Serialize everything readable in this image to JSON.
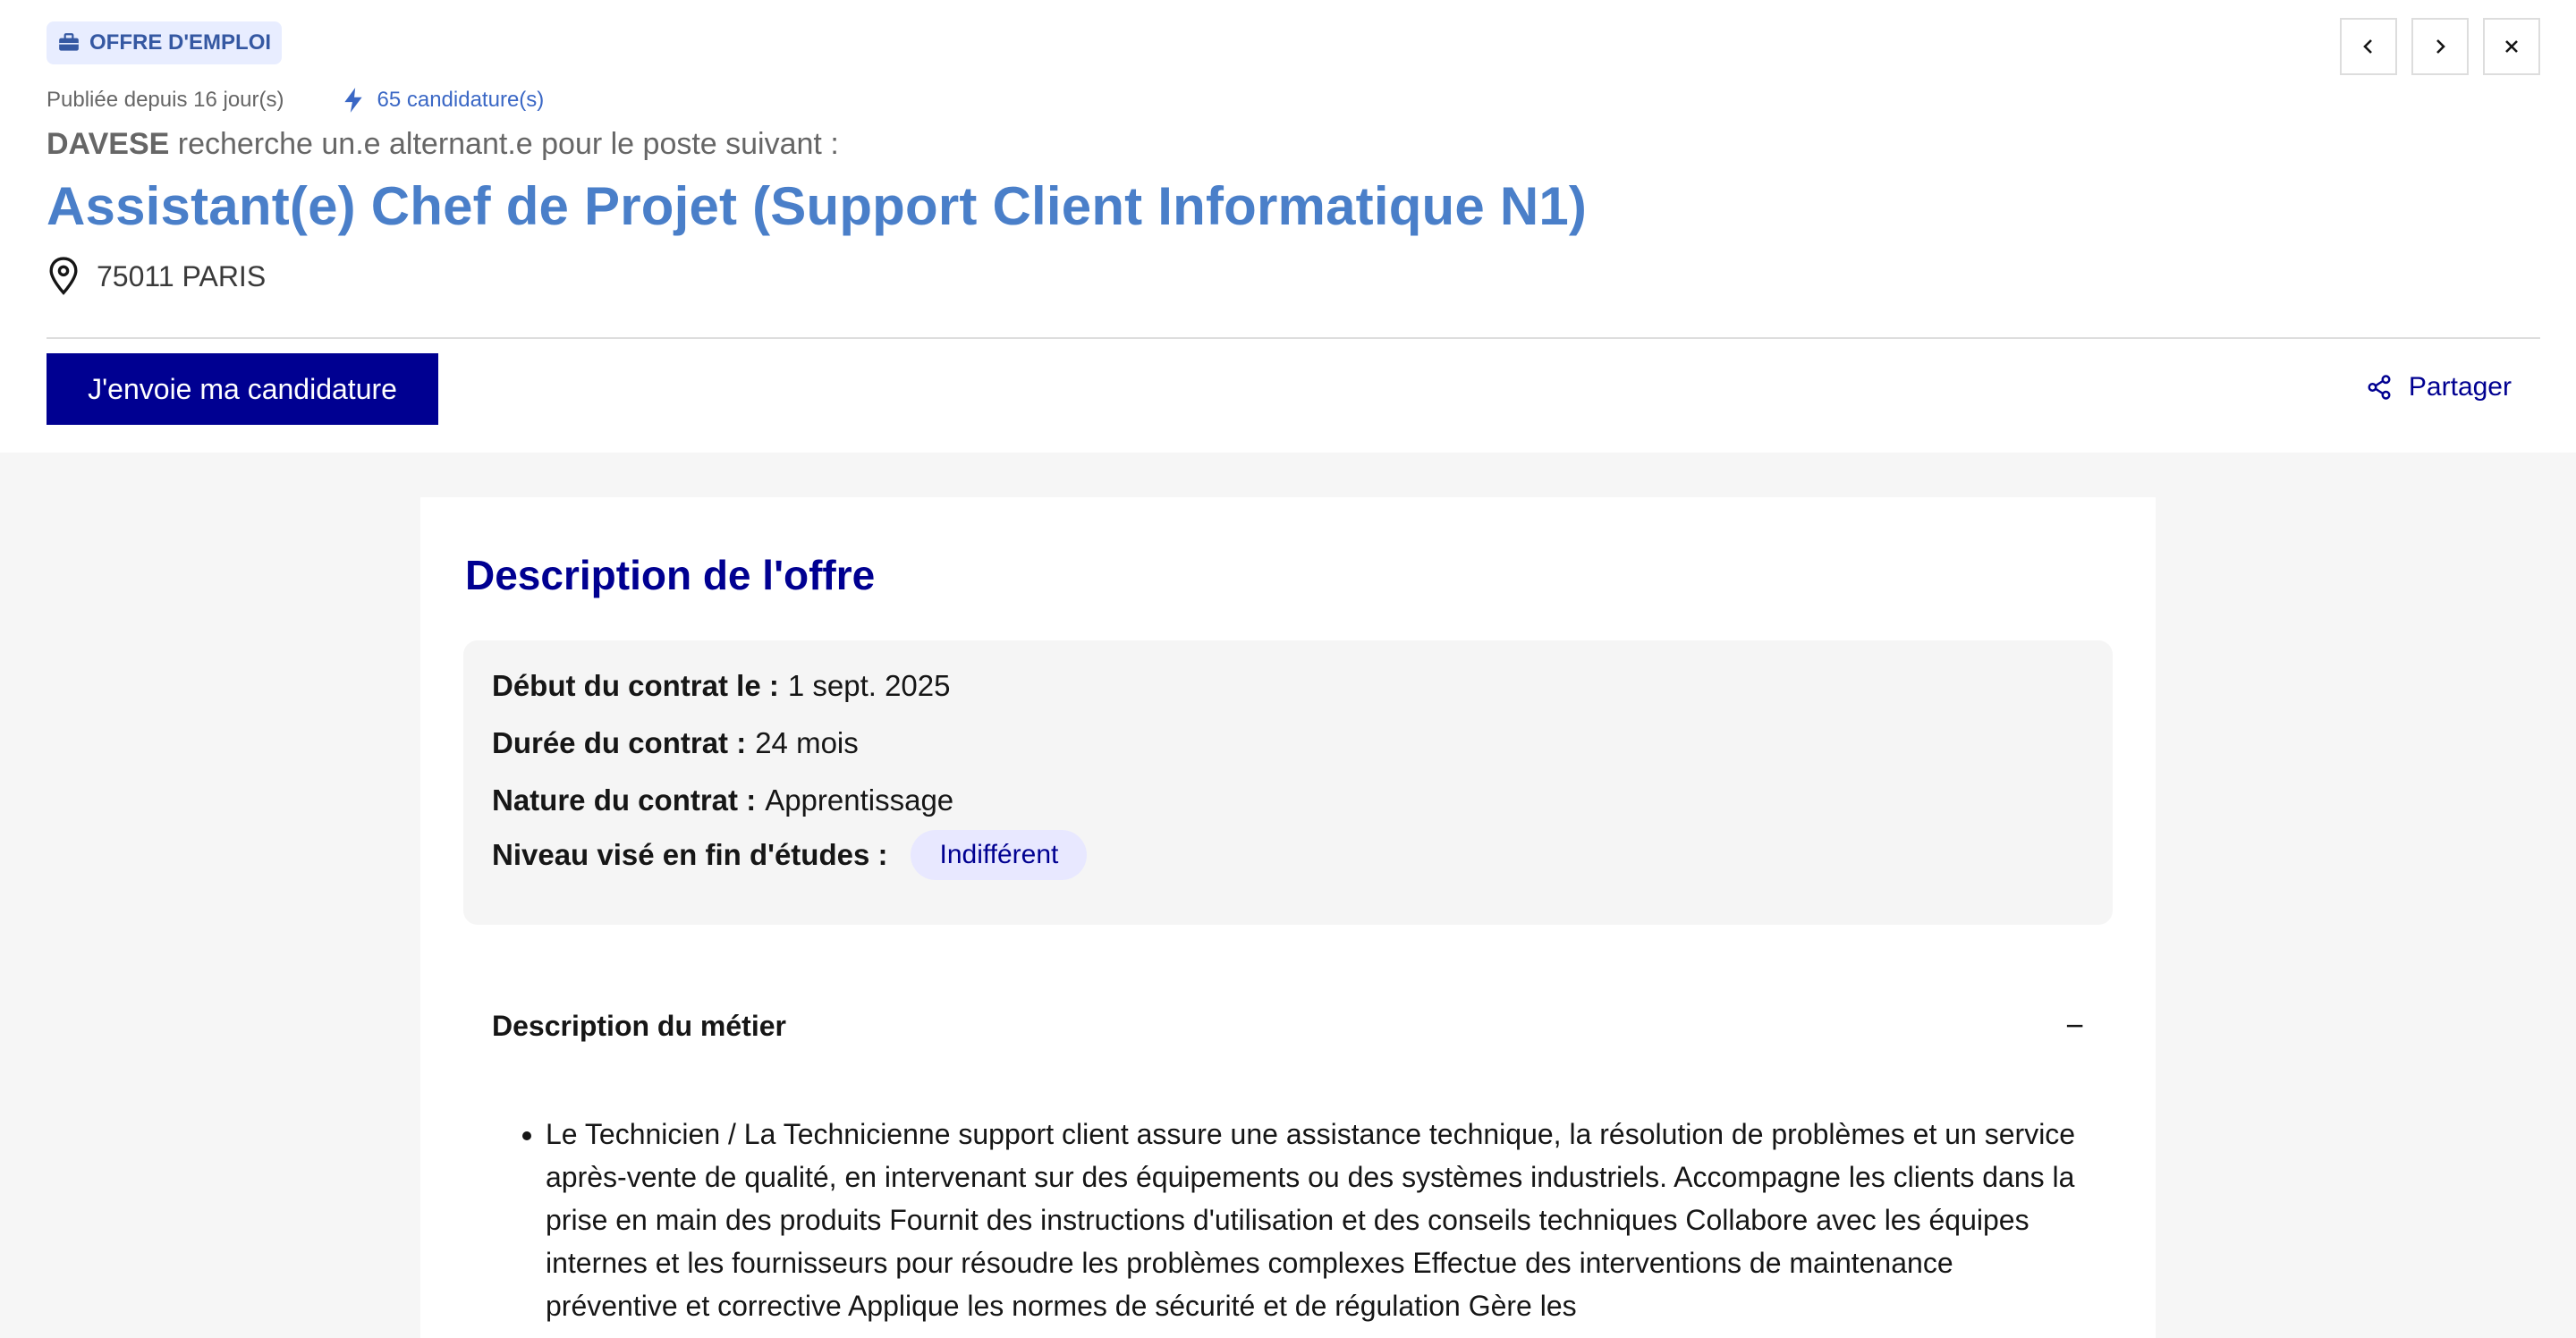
{
  "header": {
    "badge_label": "OFFRE D'EMPLOI",
    "badge_icon": "briefcase-icon",
    "published": "Publiée depuis 16 jour(s)",
    "applications": "65 candidature(s)",
    "company": "DAVESE",
    "seeker_text": "recherche un.e alternant.e pour le poste suivant :",
    "job_title": "Assistant(e) Chef de Projet (Support Client Informatique N1)",
    "location": "75011 PARIS",
    "apply_label": "J'envoie ma candidature",
    "share_label": "Partager"
  },
  "description": {
    "heading": "Description de l'offre",
    "start_label": "Début du contrat le :",
    "start_value": "1 sept. 2025",
    "duration_label": "Durée du contrat :",
    "duration_value": "24 mois",
    "nature_label": "Nature du contrat :",
    "nature_value": "Apprentissage",
    "level_label": "Niveau visé en fin d'études :",
    "level_value": "Indifférent"
  },
  "accordion": {
    "title": "Description du métier",
    "toggle": "−",
    "body": "Le Technicien / La Technicienne support client assure une assistance technique, la résolution de problèmes et un service après-vente de qualité, en intervenant sur des équipements ou des systèmes industriels. Accompagne les clients dans la prise en main des produits Fournit des instructions d'utilisation et des conseils techniques Collabore avec les équipes internes et les fournisseurs pour résoudre les problèmes complexes Effectue des interventions de maintenance préventive et corrective Applique les normes de sécurité et de régulation Gère les"
  },
  "colors": {
    "primary": "#000091",
    "title_blue": "#4a7fc9",
    "badge_bg": "#e8edff"
  }
}
